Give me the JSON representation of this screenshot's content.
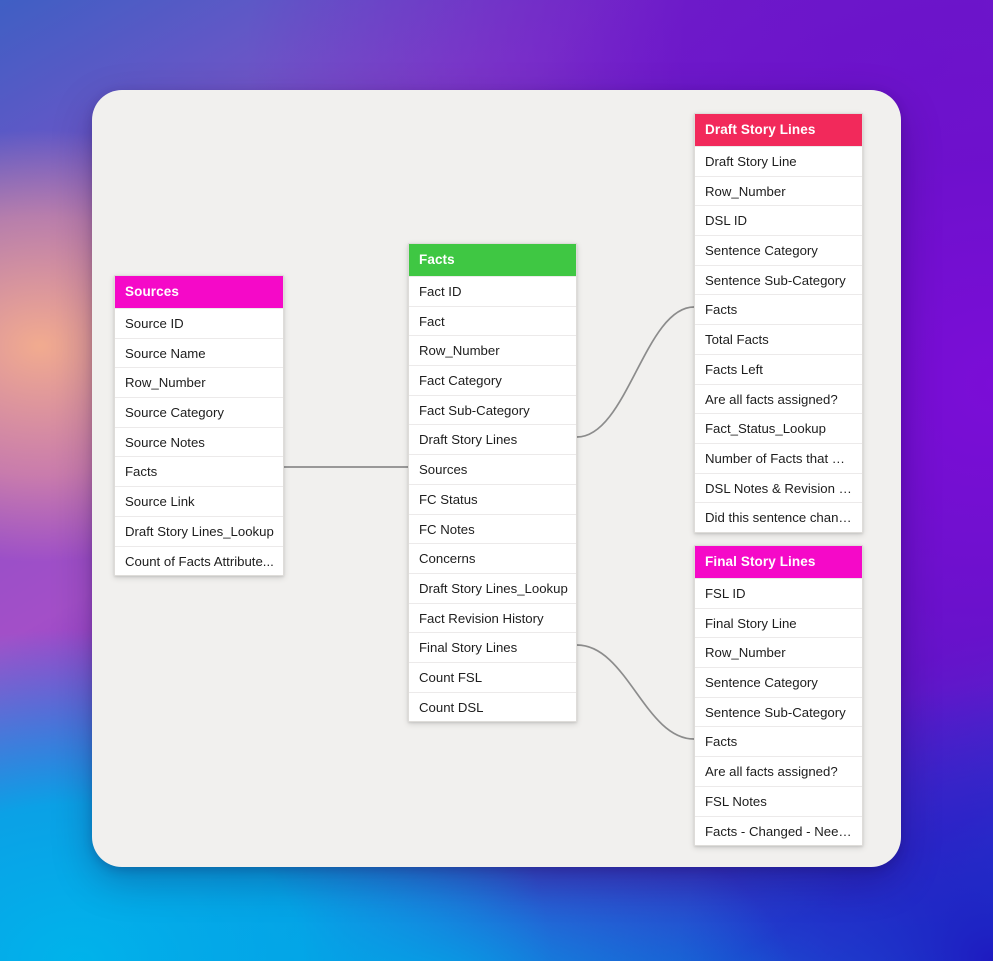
{
  "canvas": {
    "background_colors": {
      "panel": "#f1f0ee",
      "wallpaper_top_left": "#3f5fc4",
      "wallpaper_top_right": "#6a18c8",
      "wallpaper_left_mid": "#f2a88c",
      "wallpaper_bottom_left": "#00b0e8",
      "wallpaper_bottom_right": "#2012be"
    },
    "connector_color": "#8c8c8c"
  },
  "tables": [
    {
      "id": "sources",
      "title": "Sources",
      "header_color": "#f509c8",
      "fields": [
        "Source ID",
        "Source Name",
        "Row_Number",
        "Source Category",
        "Source Notes",
        "Facts",
        "Source Link",
        "Draft Story Lines_Lookup",
        "Count of Facts Attribute..."
      ]
    },
    {
      "id": "facts",
      "title": "Facts",
      "header_color": "#3fc743",
      "fields": [
        "Fact ID",
        "Fact",
        "Row_Number",
        "Fact Category",
        "Fact Sub-Category",
        "Draft Story Lines",
        "Sources",
        "FC Status",
        "FC Notes",
        "Concerns",
        "Draft Story Lines_Lookup",
        "Fact Revision History",
        "Final Story Lines",
        "Count FSL",
        "Count DSL"
      ]
    },
    {
      "id": "draft_story_lines",
      "title": "Draft Story Lines",
      "header_color": "#f2295b",
      "fields": [
        "Draft Story Line",
        "Row_Number",
        "DSL ID",
        "Sentence Category",
        "Sentence Sub-Category",
        "Facts",
        "Total Facts",
        "Facts Left",
        "Are all facts assigned?",
        "Fact_Status_Lookup",
        "Number of Facts that Ne...",
        "DSL Notes & Revision Hi...",
        "Did this sentence chang..."
      ]
    },
    {
      "id": "final_story_lines",
      "title": "Final Story Lines",
      "header_color": "#f509c8",
      "fields": [
        "FSL ID",
        "Final Story Line",
        "Row_Number",
        "Sentence Category",
        "Sentence Sub-Category",
        "Facts",
        "Are all facts assigned?",
        "FSL Notes",
        "Facts - Changed - Need..."
      ]
    }
  ],
  "relationships": [
    {
      "id": "sources-facts",
      "from": "Sources.Facts",
      "to": "Facts.Sources"
    },
    {
      "id": "facts-dsl",
      "from": "Facts.Draft Story Lines",
      "to": "Draft Story Lines.Facts"
    },
    {
      "id": "facts-fsl",
      "from": "Facts.Final Story Lines",
      "to": "Final Story Lines.Facts"
    }
  ]
}
